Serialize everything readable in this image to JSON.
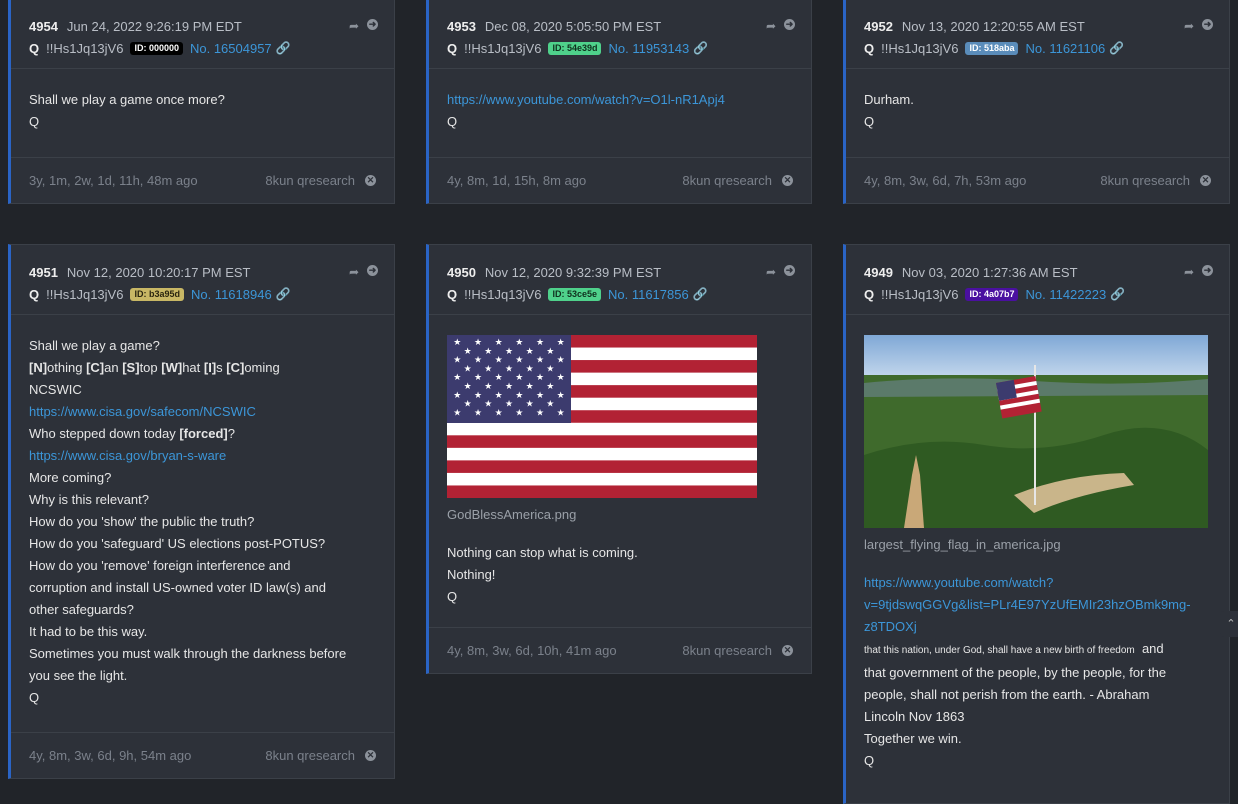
{
  "cards": [
    {
      "num": "4954",
      "date": "Jun 24, 2022 9:26:19 PM EDT",
      "name": "Q",
      "trip": "!!Hs1Jq13jV6",
      "id_label": "ID: 000000",
      "id_bg": "#000000",
      "id_fg": "#ffffff",
      "post_no": "No. 16504957",
      "lines": [
        "Shall we play a game once more?",
        "Q"
      ],
      "age": "3y, 1m, 2w, 1d, 11h, 48m ago",
      "source": "8kun qresearch"
    },
    {
      "num": "4953",
      "date": "Dec 08, 2020 5:05:50 PM EST",
      "name": "Q",
      "trip": "!!Hs1Jq13jV6",
      "id_label": "ID: 54e39d",
      "id_bg": "#4fd18b",
      "id_fg": "#10301e",
      "post_no": "No. 11953143",
      "link": "https://www.youtube.com/watch?v=O1l-nR1Apj4",
      "lines": [
        "Q"
      ],
      "age": "4y, 8m, 1d, 15h, 8m ago",
      "source": "8kun qresearch"
    },
    {
      "num": "4952",
      "date": "Nov 13, 2020 12:20:55 AM EST",
      "name": "Q",
      "trip": "!!Hs1Jq13jV6",
      "id_label": "ID: 518aba",
      "id_bg": "#5a8cba",
      "id_fg": "#ffffff",
      "post_no": "No. 11621106",
      "lines": [
        "Durham.",
        "Q"
      ],
      "age": "4y, 8m, 3w, 6d, 7h, 53m ago",
      "source": "8kun qresearch"
    },
    {
      "num": "4951",
      "date": "Nov 12, 2020 10:20:17 PM EST",
      "name": "Q",
      "trip": "!!Hs1Jq13jV6",
      "id_label": "ID: b3a95d",
      "id_bg": "#c8b765",
      "id_fg": "#2a2510",
      "post_no": "No. 11618946",
      "body": [
        "Shall we play a game?",
        "[N]othing [C]an [S]top [W]hat [I]s [C]oming",
        "NCSWIC",
        "https://www.cisa.gov/safecom/NCSWIC",
        "Who stepped down today [forced]?",
        "https://www.cisa.gov/bryan-s-ware",
        "More coming?",
        "Why is this relevant?",
        "How do you 'show' the public the truth?",
        "How do you 'safeguard' US elections post-POTUS?",
        "How do you 'remove' foreign interference and",
        "corruption and install US-owned voter ID law(s) and",
        "other safeguards?",
        "It had to be this way.",
        "Sometimes you must walk through the darkness before",
        "you see the light.",
        "Q"
      ],
      "age": "4y, 8m, 3w, 6d, 9h, 54m ago",
      "source": "8kun qresearch"
    },
    {
      "num": "4950",
      "date": "Nov 12, 2020 9:32:39 PM EST",
      "name": "Q",
      "trip": "!!Hs1Jq13jV6",
      "id_label": "ID: 53ce5e",
      "id_bg": "#4fd18b",
      "id_fg": "#10301e",
      "post_no": "No. 11617856",
      "file": "GodBlessAmerica.png",
      "lines": [
        "Nothing can stop what is coming.",
        "Nothing!",
        "Q"
      ],
      "age": "4y, 8m, 3w, 6d, 10h, 41m ago",
      "source": "8kun qresearch"
    },
    {
      "num": "4949",
      "date": "Nov 03, 2020 1:27:36 AM EST",
      "name": "Q",
      "trip": "!!Hs1Jq13jV6",
      "id_label": "ID: 4a07b7",
      "id_bg": "#4a10a0",
      "id_fg": "#ffffff",
      "post_no": "No. 11422223",
      "file": "largest_flying_flag_in_america.jpg",
      "link_lines": [
        "https://www.youtube.com/watch?",
        "v=9tjdswqGGVg&list=PLr4E97YzUfEMIr23hzOBmk9mg-",
        "z8TDOXj"
      ],
      "small": "that this nation, under God, shall have a new birth of freedom",
      "small_tail": "and",
      "lines": [
        "that government of the people, by the people, for the",
        "people, shall not perish from the earth. - Abraham",
        "Lincoln Nov 1863",
        "Together we win.",
        "Q"
      ]
    }
  ],
  "colors": {
    "accent": "#2a64c5",
    "link": "#3c96d8",
    "card_bg": "#2d3139",
    "page_bg": "#212429"
  },
  "icons": {
    "share": "share-icon",
    "goto": "arrow-right-circle-icon",
    "close": "close-circle-icon",
    "chain": "link-icon"
  }
}
